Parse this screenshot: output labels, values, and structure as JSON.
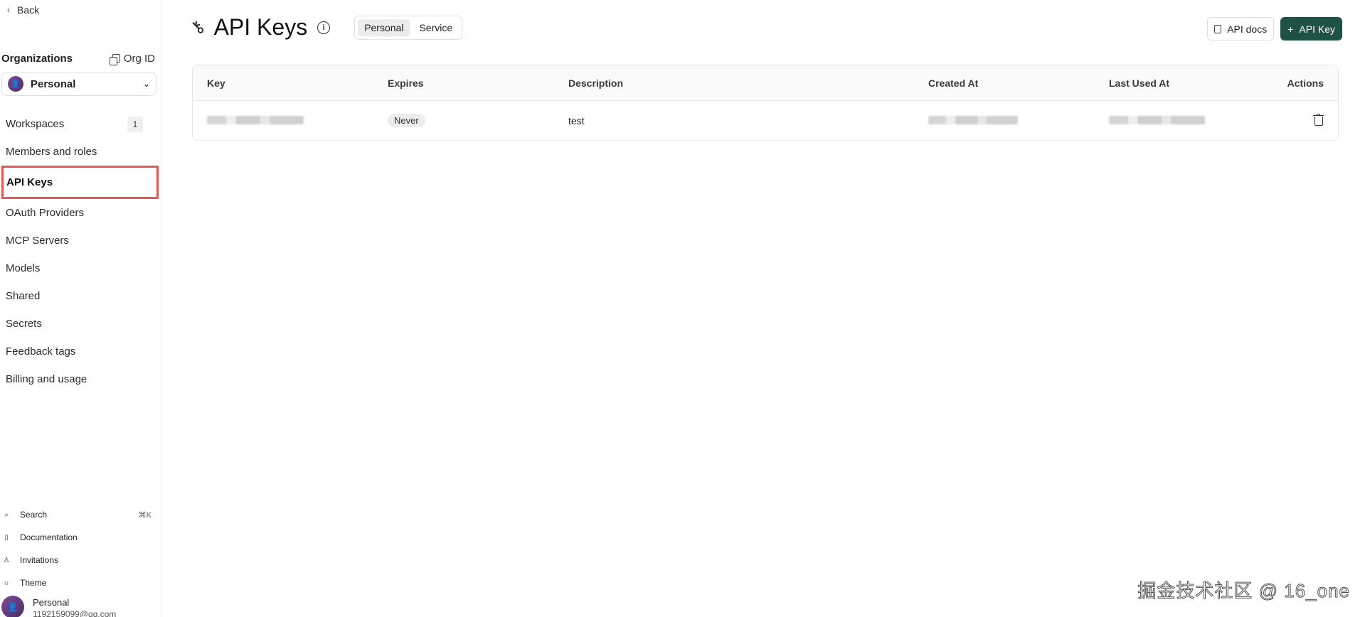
{
  "sidebar": {
    "back_label": "Back",
    "org_section_title": "Organizations",
    "org_id_label": "Org ID",
    "org_selected": "Personal",
    "items": [
      {
        "label": "Workspaces",
        "badge": "1"
      },
      {
        "label": "Members and roles"
      },
      {
        "label": "API Keys",
        "active": true
      },
      {
        "label": "OAuth Providers"
      },
      {
        "label": "MCP Servers"
      },
      {
        "label": "Models"
      },
      {
        "label": "Shared"
      },
      {
        "label": "Secrets"
      },
      {
        "label": "Feedback tags"
      },
      {
        "label": "Billing and usage"
      }
    ],
    "bottom": {
      "search": "Search",
      "search_shortcut": "⌘K",
      "documentation": "Documentation",
      "invitations": "Invitations",
      "theme": "Theme"
    },
    "profile": {
      "name": "Personal",
      "email": "1192159099@qq.com"
    }
  },
  "main": {
    "title": "API Keys",
    "tabs": [
      "Personal",
      "Service"
    ],
    "active_tab": "Personal",
    "buttons": {
      "docs": "API docs",
      "add": "API Key"
    },
    "table": {
      "columns": [
        "Key",
        "Expires",
        "Description",
        "Created At",
        "Last Used At",
        "Actions"
      ],
      "rows": [
        {
          "expires": "Never",
          "description": "test"
        }
      ]
    }
  },
  "watermark": "掘金技术社区 @ 16_one",
  "colors": {
    "primary": "#1f5245",
    "active_outline": "#e05a5a"
  }
}
